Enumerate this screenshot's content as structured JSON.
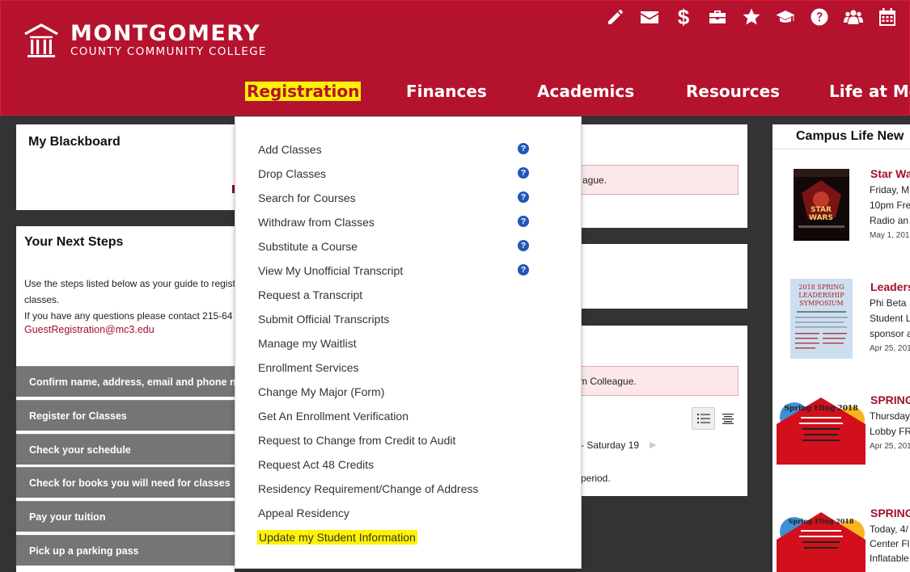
{
  "college": {
    "name_line1": "MONTGOMERY",
    "name_line2": "COUNTY COMMUNITY COLLEGE"
  },
  "utility_icons": [
    "pencil-icon",
    "envelope-icon",
    "dollar-icon",
    "briefcase-icon",
    "star-icon",
    "graduation-cap-icon",
    "help-circle-icon",
    "users-icon",
    "calendar-icon"
  ],
  "nav": {
    "registration": "Registration",
    "finances": "Finances",
    "academics": "Academics",
    "resources": "Resources",
    "life": "Life at Mo"
  },
  "blackboard": {
    "title": "My Blackboard"
  },
  "next_steps": {
    "title": "Your Next Steps",
    "intro_line1": "Use the steps listed below as your guide to regist",
    "intro_line2": "classes.",
    "intro_line3": "If you have any questions please contact 215-64",
    "email": "GuestRegistration@mc3.edu",
    "steps": [
      "Confirm name, address, email and phone nu",
      "Register for Classes",
      "Check your schedule",
      "Check for books you will need for classes",
      "Pay your tuition",
      "Pick up a parking pass"
    ]
  },
  "middle": {
    "alert1": "ague.",
    "alert2": "m Colleague.",
    "date_text": "- Saturday 19",
    "arrow": "▶",
    "period_text": "period."
  },
  "news": {
    "title": "Campus Life New",
    "items": [
      {
        "title": "Star Wa",
        "lines": [
          "Friday, M",
          "10pm Fre",
          "Radio an"
        ],
        "date": "May 1, 201"
      },
      {
        "title": "Leaders",
        "lines": [
          "Phi Beta",
          "Student L",
          "sponsor a"
        ],
        "date": "Apr 25, 201"
      },
      {
        "title": "SPRING",
        "lines": [
          "Thursday",
          "Lobby FR"
        ],
        "date": "Apr 25, 201"
      },
      {
        "title": "SPRING",
        "lines": [
          "Today, 4/",
          "Center Fl",
          "Inflatable"
        ],
        "date": ""
      }
    ],
    "thumb2_text": [
      "2018 SPRING",
      "LEADERSHIP",
      "SYMPOSIUM"
    ],
    "thumb1_text": [
      "STAR",
      "WARS"
    ],
    "thumb3_text": [
      "Spring Fling 2018"
    ],
    "thumb4_text": [
      "Spring Fling 2018"
    ]
  },
  "dropdown": {
    "items": [
      "Add Classes",
      "Drop Classes",
      "Search for Courses",
      "Withdraw from Classes",
      "Substitute a Course",
      "View My Unofficial Transcript",
      "Request a Transcript",
      "Submit Official Transcripts",
      "Manage my Waitlist",
      "Enrollment Services",
      "Change My Major (Form)",
      "Get An Enrollment Verification",
      "Request to Change from Credit to Audit",
      "Request Act 48 Credits",
      "Residency Requirement/Change of Address",
      "Appeal Residency",
      "Update my Student Information"
    ],
    "help_glyph": "?"
  },
  "colors": {
    "brand_red": "#b5122e",
    "highlight_yellow": "#fff200",
    "help_blue": "#2456b8",
    "step_gray": "#757575"
  }
}
